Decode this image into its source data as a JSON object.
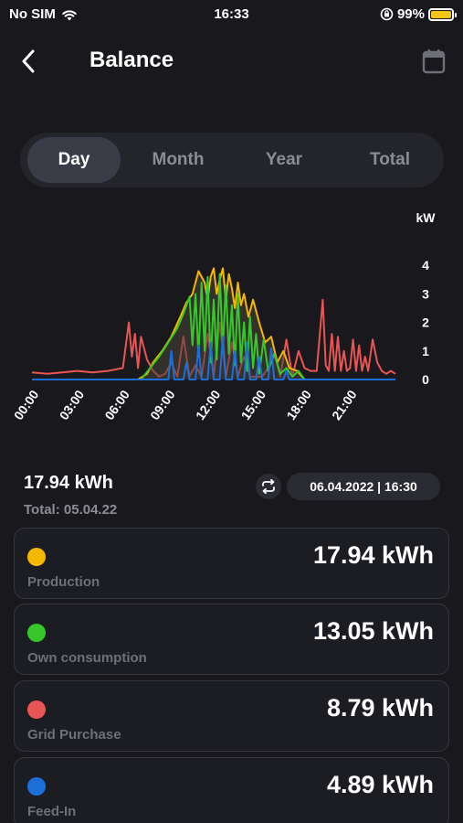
{
  "status": {
    "carrier": "No SIM",
    "time": "16:33",
    "battery": "99%",
    "battery_level": 0.99
  },
  "header": {
    "title": "Balance"
  },
  "tabs": [
    {
      "label": "Day",
      "active": true
    },
    {
      "label": "Month",
      "active": false
    },
    {
      "label": "Year",
      "active": false
    },
    {
      "label": "Total",
      "active": false
    }
  ],
  "chart_data": {
    "type": "line",
    "xlabel": "",
    "ylabel": "kW",
    "x_tick_labels": [
      "00:00",
      "03:00",
      "06:00",
      "09:00",
      "12:00",
      "15:00",
      "18:00",
      "21:00"
    ],
    "y_tick_labels": [
      "0",
      "1",
      "2",
      "3",
      "4"
    ],
    "ylim": [
      0,
      4.2
    ],
    "xlim": [
      0,
      24
    ],
    "x_unit": "hour",
    "grid": false,
    "series": [
      {
        "color": "#e85555",
        "x": [
          0,
          1,
          2,
          3,
          4,
          5,
          6,
          6.4,
          6.6,
          6.8,
          7.0,
          7.2,
          7.6,
          8.0,
          8.4,
          8.8,
          9.2,
          9.6,
          10.0,
          10.4,
          10.8,
          11.2,
          11.6,
          12.0,
          12.4,
          12.8,
          13.2,
          13.6,
          14.0,
          14.4,
          14.8,
          15.2,
          15.6,
          16.0,
          16.4,
          16.8,
          17.2,
          17.6,
          18.0,
          18.4,
          18.8,
          19.2,
          19.4,
          19.6,
          19.8,
          20.0,
          20.2,
          20.4,
          20.6,
          20.8,
          21.0,
          21.2,
          21.4,
          21.6,
          21.8,
          22.0,
          22.2,
          22.5,
          22.8,
          23.1,
          23.4,
          23.7,
          24
        ],
        "values": [
          0.25,
          0.2,
          0.25,
          0.3,
          0.25,
          0.3,
          0.4,
          2.0,
          0.8,
          1.6,
          0.4,
          1.5,
          0.7,
          0.3,
          0.1,
          0.2,
          0.6,
          0.1,
          1.5,
          0.1,
          0.5,
          0.1,
          1.6,
          0.1,
          2.0,
          0.1,
          1.3,
          0.1,
          0.8,
          0.1,
          0.1,
          0.1,
          0.4,
          0.9,
          0.1,
          1.4,
          0.1,
          1.0,
          0.4,
          0.3,
          0.3,
          2.8,
          0.5,
          0.3,
          1.6,
          0.3,
          1.5,
          0.3,
          1.0,
          0.3,
          0.4,
          1.4,
          0.3,
          1.2,
          0.3,
          0.8,
          0.3,
          1.4,
          0.6,
          0.3,
          0.2,
          0.3,
          0.2
        ]
      },
      {
        "color": "#f5b800",
        "x": [
          0,
          7.0,
          7.6,
          8.0,
          8.6,
          9.2,
          9.8,
          10.2,
          10.6,
          11.0,
          11.4,
          11.6,
          11.8,
          12.0,
          12.2,
          12.4,
          12.6,
          12.8,
          13.0,
          13.2,
          13.4,
          13.6,
          13.8,
          14.0,
          14.3,
          14.6,
          15.0,
          15.4,
          15.8,
          16.2,
          16.6,
          17.0,
          17.5,
          18.0,
          24
        ],
        "values": [
          0,
          0,
          0.2,
          0.6,
          1.0,
          1.5,
          2.2,
          2.7,
          3.0,
          3.8,
          3.4,
          2.8,
          3.6,
          3.9,
          3.0,
          3.5,
          3.9,
          2.8,
          3.7,
          3.2,
          2.5,
          3.4,
          2.6,
          3.0,
          2.2,
          2.8,
          2.0,
          1.3,
          1.5,
          0.6,
          1.0,
          0.4,
          0.3,
          0.0,
          0
        ]
      },
      {
        "color": "#36c82a",
        "x": [
          0,
          7.2,
          7.8,
          8.4,
          9.0,
          9.6,
          10.0,
          10.4,
          10.6,
          10.8,
          11.0,
          11.2,
          11.4,
          11.6,
          11.8,
          12.0,
          12.2,
          12.4,
          12.6,
          12.8,
          13.0,
          13.2,
          13.4,
          13.6,
          13.8,
          14.0,
          14.2,
          14.4,
          14.6,
          14.8,
          15.0,
          15.3,
          15.6,
          16.0,
          16.4,
          16.8,
          17.2,
          17.6,
          18.0,
          24
        ],
        "values": [
          0,
          0,
          0.4,
          0.8,
          1.3,
          1.8,
          2.3,
          2.9,
          1.2,
          3.0,
          0.8,
          3.4,
          1.0,
          3.6,
          0.6,
          2.8,
          0.7,
          3.7,
          1.1,
          3.3,
          0.9,
          2.6,
          0.5,
          3.0,
          0.6,
          2.0,
          0.3,
          2.2,
          0.4,
          1.6,
          0.2,
          1.4,
          0.3,
          0.9,
          0.2,
          0.4,
          0.1,
          0.3,
          0.0,
          0
        ]
      },
      {
        "color": "#1c6fd8",
        "x": [
          0,
          9.0,
          9.2,
          9.4,
          10.0,
          10.2,
          10.4,
          10.8,
          11.0,
          11.2,
          11.6,
          11.8,
          12.0,
          12.4,
          12.6,
          12.8,
          13.2,
          13.4,
          13.6,
          14.0,
          14.2,
          14.4,
          14.8,
          15.0,
          15.2,
          15.6,
          15.8,
          16.0,
          16.6,
          16.8,
          17.0,
          24
        ],
        "values": [
          0,
          0,
          1.0,
          0,
          0,
          0.6,
          0,
          0,
          1.2,
          0,
          0,
          1.3,
          0,
          0,
          1.5,
          0,
          0,
          1.0,
          0,
          0,
          1.3,
          0,
          0,
          0.8,
          0,
          0,
          1.1,
          0,
          0,
          0.3,
          0,
          0
        ]
      }
    ]
  },
  "summary": {
    "value": "17.94 kWh",
    "total": "Total: 05.04.22",
    "date": "06.04.2022 | 16:30"
  },
  "cards": [
    {
      "label": "Production",
      "value": "17.94 kWh",
      "color": "#f5b800"
    },
    {
      "label": "Own consumption",
      "value": "13.05 kWh",
      "color": "#36c82a"
    },
    {
      "label": "Grid Purchase",
      "value": "8.79 kWh",
      "color": "#e85555"
    },
    {
      "label": "Feed-In",
      "value": "4.89 kWh",
      "color": "#1c6fd8"
    }
  ]
}
